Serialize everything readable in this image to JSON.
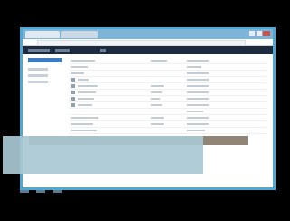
{
  "window": {
    "tabs": [
      "",
      ""
    ]
  },
  "colors": {
    "background": "#000000",
    "screen_border": "#4aa9d6",
    "navbar": "#1e2b3e",
    "accent": "#3c7cc1",
    "highlight_band": "#8a7e6f",
    "overlay_panel": "#a9c8d3"
  },
  "sidebar": {
    "item_count": 4
  },
  "table": {
    "row_count": 12
  }
}
